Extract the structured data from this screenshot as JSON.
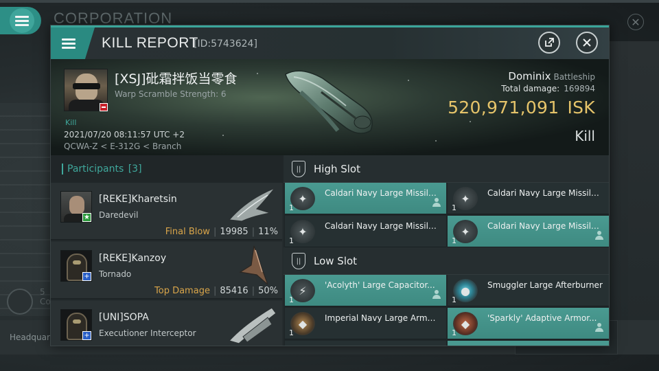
{
  "background": {
    "title": "CORPORATION",
    "side_text_1": "5",
    "side_text_2": "Co",
    "bottom_text": "Headquar"
  },
  "dialog": {
    "title": "KILL REPORT",
    "id_text": "[ID:5743624]",
    "share_icon": "share-icon",
    "close_icon": "close-icon",
    "accent_color": "#3aa59a"
  },
  "victim": {
    "name": "[XSJ]砒霜拌饭当零食",
    "warp_scramble": "Warp Scramble Strength: 6",
    "kill_tag": "Kill",
    "timestamp": "2021/07/20 08:11:57 UTC +2",
    "location": "QCWA-Z < E-312G < Branch",
    "ship_name": "Dominix",
    "ship_class": "Battleship",
    "total_damage_label": "Total damage:",
    "total_damage": "169894",
    "isk_value": "520,971,091",
    "isk_currency": "ISK",
    "result": "Kill",
    "isk_color": "#e6c46a"
  },
  "participants": {
    "title": "Participants",
    "count": "[3]",
    "rows": [
      {
        "name": "[REKE]Kharetsin",
        "ship": "Daredevil",
        "tag": "Final Blow",
        "damage": "19985",
        "percent": "11%",
        "badge": "★",
        "badge_color": "#2e9b3e"
      },
      {
        "name": "[REKE]Kanzoy",
        "ship": "Tornado",
        "tag": "Top Damage",
        "damage": "85416",
        "percent": "50%",
        "badge": "+",
        "badge_color": "#2a5fc7"
      },
      {
        "name": "[UNI]SOPA",
        "ship": "Executioner Interceptor",
        "tag": "",
        "damage": "",
        "percent": "",
        "badge": "+",
        "badge_color": "#2a5fc7"
      }
    ]
  },
  "fitting": {
    "high_slot_label": "High Slot",
    "low_slot_label": "Low Slot",
    "high": [
      {
        "name": "Caldari Navy Large Missile...",
        "qty": "1",
        "state": "on"
      },
      {
        "name": "Caldari Navy Large Missile...",
        "qty": "1",
        "state": "off"
      },
      {
        "name": "Caldari Navy Large Missile...",
        "qty": "1",
        "state": "off"
      },
      {
        "name": "Caldari Navy Large Missile...",
        "qty": "1",
        "state": "on"
      }
    ],
    "low": [
      {
        "name": "'Acolyth' Large Capacitor...",
        "qty": "1",
        "state": "on"
      },
      {
        "name": "Smuggler Large Afterburner",
        "qty": "1",
        "state": "off"
      },
      {
        "name": "Imperial Navy Large Armor...",
        "qty": "1",
        "state": "off"
      },
      {
        "name": "'Sparkly' Adaptive Armor...",
        "qty": "1",
        "state": "on"
      }
    ]
  }
}
